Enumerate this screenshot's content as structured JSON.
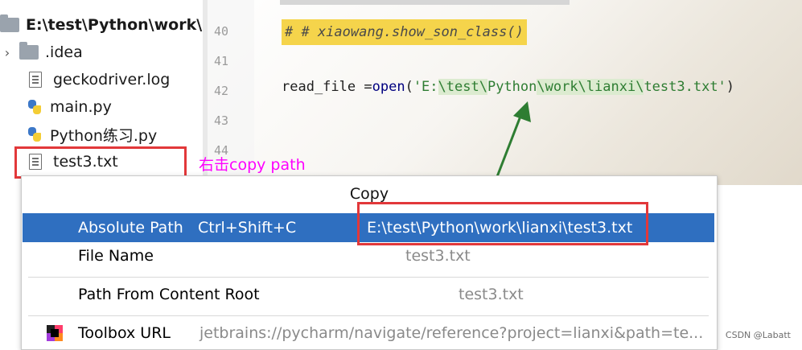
{
  "project_tree": {
    "root_label": "E:\\test\\Python\\work\\lia",
    "items": [
      {
        "label": ".idea",
        "icon": "folder-icon"
      },
      {
        "label": "geckodriver.log",
        "icon": "text-file-icon"
      },
      {
        "label": "main.py",
        "icon": "python-file-icon"
      },
      {
        "label": "Python练习.py",
        "icon": "python-file-icon"
      },
      {
        "label": "test3.txt",
        "icon": "text-file-icon"
      }
    ]
  },
  "editor": {
    "line_numbers": [
      "40",
      "41",
      "42",
      "43",
      "44"
    ],
    "comment_line": "# # xiaowang.show_son_class()",
    "code_line": {
      "var": "read_file ",
      "eq": "=",
      "func": "open",
      "paren_open": "(",
      "str_part1": "'E:",
      "str_part2": "\\test\\",
      "str_part3": "Python",
      "str_part4": "\\work\\lianxi\\",
      "str_part5": "test3.txt'",
      "paren_close": ")"
    }
  },
  "annotation": {
    "text": "右击copy path",
    "color": "#ff00ff",
    "box_color": "#e2383a",
    "arrow_color": "#2e7d32"
  },
  "copy_menu": {
    "title": "Copy",
    "items": [
      {
        "label": "Absolute Path",
        "shortcut": "Ctrl+Shift+C",
        "value": "E:\\test\\Python\\work\\lianxi\\test3.txt",
        "selected": true
      },
      {
        "label": "File Name",
        "shortcut": "",
        "value": "test3.txt",
        "selected": false
      },
      {
        "label": "Path From Content Root",
        "shortcut": "",
        "value": "test3.txt",
        "selected": false
      },
      {
        "label": "Toolbox URL",
        "shortcut": "",
        "value": "jetbrains://pycharm/navigate/reference?project=lianxi&path=te...",
        "selected": false,
        "icon": "toolbox-icon"
      }
    ],
    "selected_color": "#2f6fc0"
  },
  "watermark": "CSDN @Labatt"
}
